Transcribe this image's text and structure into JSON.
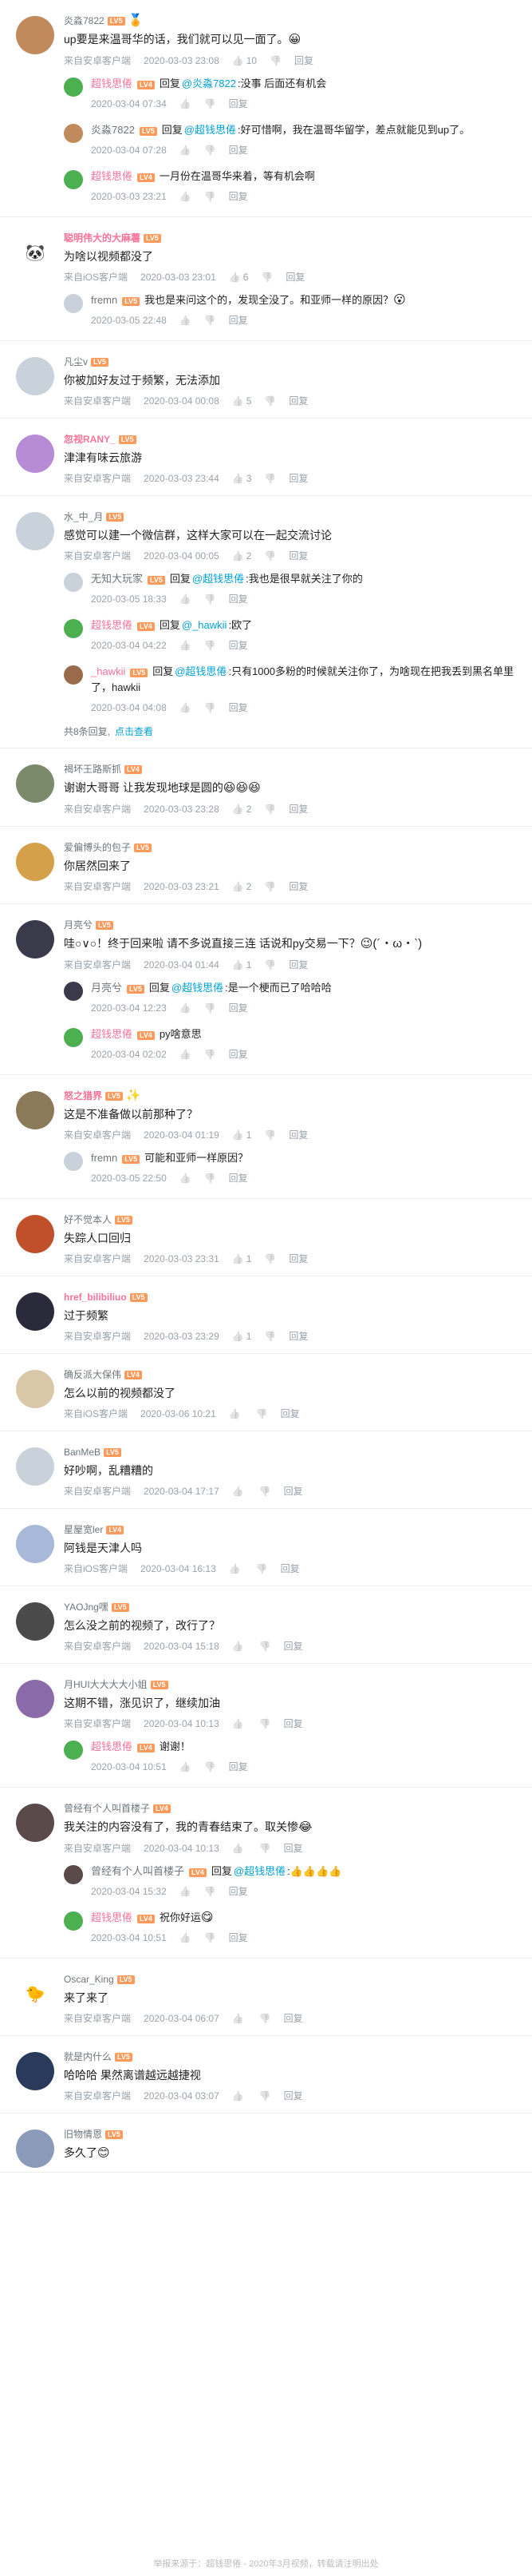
{
  "labels": {
    "reply": "回复",
    "reply_prefix": "回复",
    "at": "@",
    "colon": ":"
  },
  "threads": [
    {
      "user": "炎淼7822",
      "level": "LV5",
      "vip": false,
      "avatar_color": "#c08a5a",
      "badge": "🏅",
      "content": "up要是来温哥华的话，我们就可以见一面了。",
      "content_emoji": "😀",
      "client": "来自安卓客户端",
      "time": "2020-03-03 23:08",
      "likes": "10",
      "subs": [
        {
          "user": "超钱思倦",
          "level": "LV4",
          "vip": true,
          "avatar_color": "#4caf50",
          "target": "炎淼7822",
          "text": "没事 后面还有机会",
          "time": "2020-03-04 07:34",
          "likes": ""
        },
        {
          "user": "炎淼7822",
          "level": "LV5",
          "vip": false,
          "avatar_color": "#c08a5a",
          "target": "超钱思倦",
          "text": "好可惜啊，我在温哥华留学，差点就能见到up了。",
          "time": "2020-03-04 07:28",
          "likes": ""
        },
        {
          "user": "超钱思倦",
          "level": "LV4",
          "vip": true,
          "avatar_color": "#4caf50",
          "target": "",
          "text": "一月份在温哥华来着，等有机会啊",
          "time": "2020-03-03 23:21",
          "likes": ""
        }
      ]
    },
    {
      "user": "聪明伟大的大麻薯",
      "level": "LV5",
      "vip": true,
      "avatar_color": "#ffffff",
      "avatar_text": "🐼",
      "content": "为啥以视频都没了",
      "client": "来自iOS客户端",
      "time": "2020-03-03 23:01",
      "likes": "6",
      "subs": [
        {
          "user": "fremn",
          "level": "LV5",
          "vip": false,
          "avatar_color": "#c9d1da",
          "target": "",
          "text": "我也是来问这个的，发现全没了。和亚师一样的原因？",
          "emoji": "😮",
          "time": "2020-03-05 22:48",
          "likes": ""
        }
      ]
    },
    {
      "user": "凡尘v",
      "level": "LV5",
      "vip": false,
      "avatar_color": "#c9d1da",
      "content": "你被加好友过于频繁，无法添加",
      "client": "来自安卓客户端",
      "time": "2020-03-04 00:08",
      "likes": "5",
      "subs": []
    },
    {
      "user": "忽视RANY_",
      "level": "LV5",
      "vip": true,
      "avatar_color": "#b88bd6",
      "content": "津津有味云旅游",
      "client": "来自安卓客户端",
      "time": "2020-03-03 23:44",
      "likes": "3",
      "subs": []
    },
    {
      "user": "水_中_月",
      "level": "LV5",
      "vip": false,
      "avatar_color": "#c9d1da",
      "content": "感觉可以建一个微信群，这样大家可以在一起交流讨论",
      "client": "来自安卓客户端",
      "time": "2020-03-04 00:05",
      "likes": "2",
      "subs": [
        {
          "user": "无知大玩家",
          "level": "LV5",
          "vip": false,
          "avatar_color": "#c9d1da",
          "target": "超钱思倦",
          "text": "我也是很早就关注了你的",
          "time": "2020-03-05 18:33",
          "likes": ""
        },
        {
          "user": "超钱思倦",
          "level": "LV4",
          "vip": true,
          "avatar_color": "#4caf50",
          "target": "_hawkii",
          "text": "欧了",
          "time": "2020-03-04 04:22",
          "likes": ""
        },
        {
          "user": "_hawkii",
          "level": "LV5",
          "vip": true,
          "avatar_color": "#9a6b4b",
          "target": "超钱思倦",
          "text": "只有1000多粉的时候就关注你了，为啥现在把我丢到黑名单里了，hawkii",
          "time": "2020-03-04 04:08",
          "likes": ""
        }
      ],
      "more_text": "共8条回复,",
      "more_link": "点击查看"
    },
    {
      "user": "褐坏王路斯抓",
      "level": "LV4",
      "vip": false,
      "avatar_color": "#7a8a6a",
      "content": "谢谢大哥哥 让我发现地球是圆的",
      "content_emoji": "😆😆😆",
      "client": "来自安卓客户端",
      "time": "2020-03-03 23:28",
      "likes": "2",
      "subs": []
    },
    {
      "user": "爱偏博头的包子",
      "level": "LV5",
      "vip": false,
      "avatar_color": "#d4a04a",
      "content": "你居然回来了",
      "client": "来自安卓客户端",
      "time": "2020-03-03 23:21",
      "likes": "2",
      "subs": []
    },
    {
      "user": "月亮兮",
      "level": "LV5",
      "vip": false,
      "avatar_color": "#3a3a4a",
      "content": "哇○∨○！终于回来啦 请不多说直接三连 话说和py交易一下？",
      "content_emoji": "😉(´・ω・`)",
      "client": "来自安卓客户端",
      "time": "2020-03-04 01:44",
      "likes": "1",
      "subs": [
        {
          "user": "月亮兮",
          "level": "LV5",
          "vip": false,
          "avatar_color": "#3a3a4a",
          "target": "超钱思倦",
          "text": "是一个梗而已了哈哈哈",
          "time": "2020-03-04 12:23",
          "likes": ""
        },
        {
          "user": "超钱思倦",
          "level": "LV4",
          "vip": true,
          "avatar_color": "#4caf50",
          "target": "",
          "text": "py啥意思",
          "time": "2020-03-04 02:02",
          "likes": ""
        }
      ]
    },
    {
      "user": "怒之猎界",
      "level": "LV5",
      "vip": true,
      "avatar_color": "#8a7a5a",
      "badge": "✨",
      "content": "这是不准备做以前那种了？",
      "client": "来自安卓客户端",
      "time": "2020-03-04 01:19",
      "likes": "1",
      "subs": [
        {
          "user": "fremn",
          "level": "LV5",
          "vip": false,
          "avatar_color": "#c9d1da",
          "target": "",
          "text": "可能和亚师一样原因？",
          "time": "2020-03-05 22:50",
          "likes": ""
        }
      ]
    },
    {
      "user": "好不觉本人",
      "level": "LV5",
      "vip": false,
      "avatar_color": "#c0502a",
      "content": "失踪人口回归",
      "client": "来自安卓客户端",
      "time": "2020-03-03 23:31",
      "likes": "1",
      "subs": []
    },
    {
      "user": "href_bilibiliuo",
      "level": "LV5",
      "vip": true,
      "avatar_color": "#2a2a3a",
      "content": "过于频繁",
      "client": "来自安卓客户端",
      "time": "2020-03-03 23:29",
      "likes": "1",
      "subs": []
    },
    {
      "user": "确反派大保伟",
      "level": "LV4",
      "vip": false,
      "avatar_color": "#d8c8a8",
      "content": "怎么以前的视频都没了",
      "client": "来自iOS客户端",
      "time": "2020-03-06 10:21",
      "likes": "",
      "subs": []
    },
    {
      "user": "BanMeB",
      "level": "LV5",
      "vip": false,
      "avatar_color": "#c9d1da",
      "content": "好吵啊，乱糟糟的",
      "client": "来自安卓客户端",
      "time": "2020-03-04 17:17",
      "likes": "",
      "subs": []
    },
    {
      "user": "星屋宽ler",
      "level": "LV4",
      "vip": false,
      "avatar_color": "#a8b8d8",
      "content": "阿钱是天津人吗",
      "client": "来自iOS客户端",
      "time": "2020-03-04 16:13",
      "likes": "",
      "subs": []
    },
    {
      "user": "YAOJng嘿",
      "level": "LV5",
      "vip": false,
      "avatar_color": "#4a4a4a",
      "content": "怎么没之前的视频了，改行了？",
      "client": "来自安卓客户端",
      "time": "2020-03-04 15:18",
      "likes": "",
      "subs": []
    },
    {
      "user": "月HUI大大大大小姐",
      "level": "LV5",
      "vip": false,
      "avatar_color": "#8a6aa8",
      "content": "这期不错，涨见识了，继续加油",
      "client": "来自安卓客户端",
      "time": "2020-03-04 10:13",
      "likes": "",
      "subs": [
        {
          "user": "超钱思倦",
          "level": "LV4",
          "vip": true,
          "avatar_color": "#4caf50",
          "target": "",
          "text": "谢谢！",
          "time": "2020-03-04 10:51",
          "likes": ""
        }
      ]
    },
    {
      "user": "曾经有个人叫首楼子",
      "level": "LV4",
      "vip": false,
      "avatar_color": "#5a4a4a",
      "content": "我关注的内容没有了，我的青春结束了。取关惨",
      "content_emoji": "😂",
      "client": "来自安卓客户端",
      "time": "2020-03-04 10:13",
      "likes": "",
      "subs": [
        {
          "user": "曾经有个人叫首楼子",
          "level": "LV4",
          "vip": false,
          "avatar_color": "#5a4a4a",
          "target": "超钱思倦",
          "text": "👍👍👍👍",
          "time": "2020-03-04 15:32",
          "likes": ""
        },
        {
          "user": "超钱思倦",
          "level": "LV4",
          "vip": true,
          "avatar_color": "#4caf50",
          "target": "",
          "text": "祝你好运",
          "emoji": "😋",
          "time": "2020-03-04 10:51",
          "likes": ""
        }
      ]
    },
    {
      "user": "Oscar_King",
      "level": "LV5",
      "vip": false,
      "avatar_color": "#ffffff",
      "avatar_text": "🐤",
      "content": "来了来了",
      "client": "来自安卓客户端",
      "time": "2020-03-04 06:07",
      "likes": "",
      "subs": []
    },
    {
      "user": "就是内什么",
      "level": "LV5",
      "vip": false,
      "avatar_color": "#2a3a5a",
      "content": "哈哈哈 果然离谱越远越捷视",
      "client": "来自安卓客户端",
      "time": "2020-03-04 03:07",
      "likes": "",
      "subs": []
    },
    {
      "user": "旧物情恩",
      "level": "LV5",
      "vip": false,
      "avatar_color": "#8a9ab8",
      "content": "多久了",
      "content_emoji": "😊",
      "client": "",
      "time": "",
      "likes": "",
      "subs": []
    }
  ],
  "footer": "举报来源于：超钱思倦 - 2020年3月视频，转载请注明出处"
}
